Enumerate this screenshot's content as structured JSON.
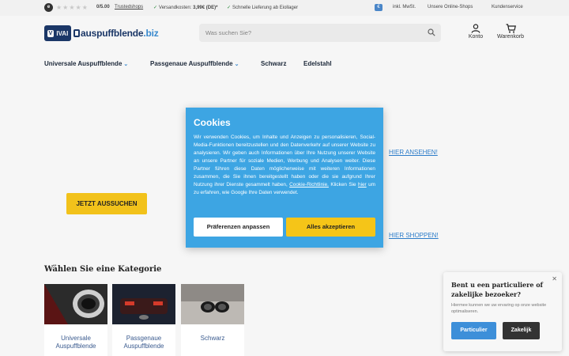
{
  "topbar": {
    "trustedshops_badge": "e",
    "stars": "★★★★★",
    "score": "0/5.00",
    "trustedshops_link": "Trustedshops",
    "usp1_prefix": "Versandkosten: ",
    "usp1_value": "3,99€ (DE)*",
    "usp2": "Schnelle Lieferung ab Eiollager",
    "vat": "inkl. MwSt.",
    "shops": "Unsere Online-Shops",
    "service": "Kundenservice"
  },
  "header": {
    "logo_badge_letter": "V",
    "logo_badge_text": "IVAI",
    "logo_name": "auspuffblende",
    "logo_tld": ".biz",
    "search_placeholder": "Was suchen Sie?",
    "account_label": "Konto",
    "cart_label": "Warenkorb"
  },
  "nav": {
    "items": [
      "Universale Auspuffblende",
      "Passgenaue Auspuffblende",
      "Schwarz",
      "Edelstahl"
    ]
  },
  "hero": {
    "link1": "HIER ANSEHEN!",
    "cta": "JETZT AUSSUCHEN",
    "link2": "HIER SHOPPEN!"
  },
  "categories": {
    "title": "Wählen Sie eine Kategorie",
    "items": [
      {
        "label": "Universale Auspuffblende"
      },
      {
        "label": "Passgenaue Auspuffblende"
      },
      {
        "label": "Schwarz"
      }
    ]
  },
  "cookie": {
    "title": "Cookies",
    "text1": "Wir verwenden Cookies, um Inhalte und Anzeigen zu personalisieren, Social-Media-Funktionen bereitzustellen und den Datenverkehr auf unserer Website zu analysieren. Wir geben auch Informationen über Ihre Nutzung unserer Website an unsere Partner für soziale Medien, Werbung und Analysen weiter. Diese Partner führen diese Daten möglicherweise mit weiteren Informationen zusammen, die Sie ihnen bereitgestellt haben oder die sie aufgrund Ihrer Nutzung ihrer Dienste gesammelt haben, ",
    "policy_link": "Cookie-Richtlinie.",
    "text2": " Klicken Sie ",
    "here_link": "hier",
    "text3": " um zu erfahren, wie Google Ihre Daten verwendet.",
    "btn_preferences": "Präferenzen anpassen",
    "btn_accept": "Alles akzeptieren"
  },
  "b2b": {
    "question": "Bent u een particuliere of zakelijke bezoeker?",
    "subtext": "Hiermee kunnen we uw ervaring op onze website optimaliseren.",
    "btn_private": "Particulier",
    "btn_business": "Zakelijk",
    "close": "✕"
  }
}
